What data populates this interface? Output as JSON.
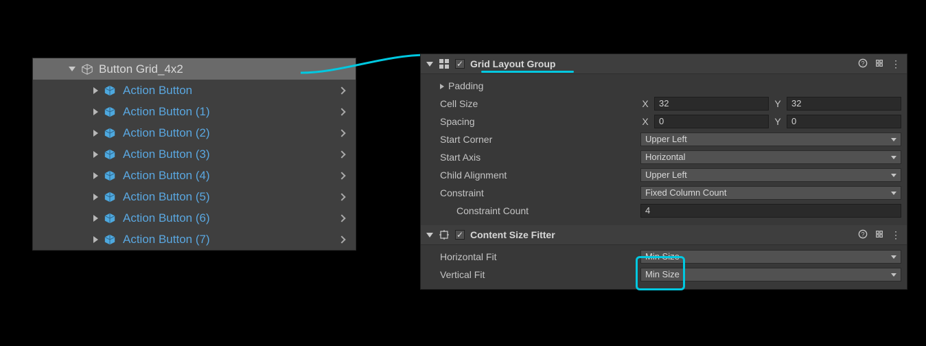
{
  "hierarchy": {
    "parent_label": "Button Grid_4x2",
    "children": [
      "Action Button",
      "Action Button (1)",
      "Action Button (2)",
      "Action Button (3)",
      "Action Button (4)",
      "Action Button (5)",
      "Action Button (6)",
      "Action Button (7)"
    ]
  },
  "inspector": {
    "grid_layout_group": {
      "title": "Grid Layout Group",
      "padding_label": "Padding",
      "cell_size": {
        "label": "Cell Size",
        "x_label": "X",
        "x": "32",
        "y_label": "Y",
        "y": "32"
      },
      "spacing": {
        "label": "Spacing",
        "x_label": "X",
        "x": "0",
        "y_label": "Y",
        "y": "0"
      },
      "start_corner": {
        "label": "Start Corner",
        "value": "Upper Left"
      },
      "start_axis": {
        "label": "Start Axis",
        "value": "Horizontal"
      },
      "child_alignment": {
        "label": "Child Alignment",
        "value": "Upper Left"
      },
      "constraint": {
        "label": "Constraint",
        "value": "Fixed Column Count"
      },
      "constraint_count": {
        "label": "Constraint Count",
        "value": "4"
      }
    },
    "content_size_fitter": {
      "title": "Content Size Fitter",
      "horizontal_fit": {
        "label": "Horizontal Fit",
        "value": "Min Size"
      },
      "vertical_fit": {
        "label": "Vertical Fit",
        "value": "Min Size"
      }
    }
  },
  "accent_color": "#00c8e0"
}
